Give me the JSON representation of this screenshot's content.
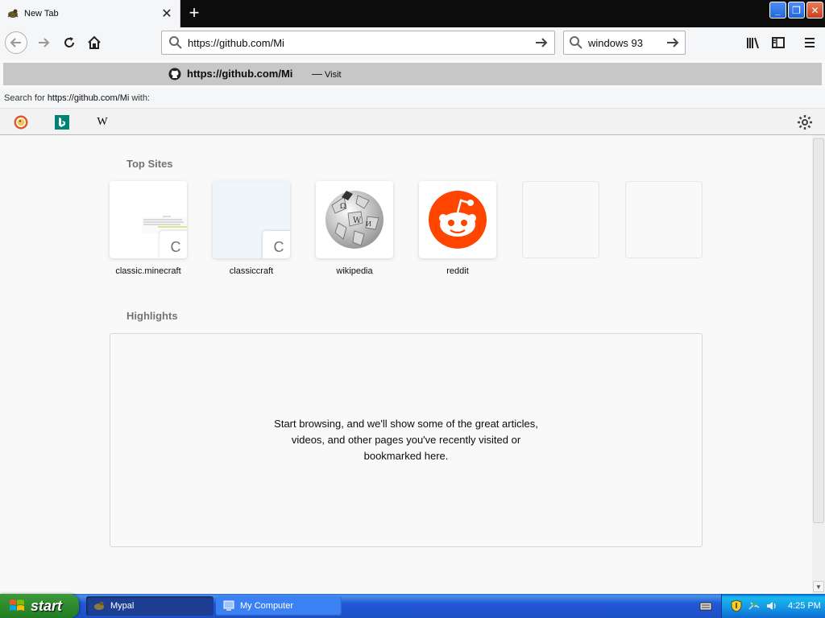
{
  "tab": {
    "title": "New Tab",
    "close_symbol": "✕"
  },
  "newtab": {
    "symbol": "+"
  },
  "window_controls": {
    "minimize": "_",
    "restore": "❐",
    "close": "✕"
  },
  "urlbar": {
    "value": "https://github.com/Mi"
  },
  "searchbar": {
    "value": "windows 93"
  },
  "autocomplete": {
    "url": "https://github.com/Mi",
    "dash": "—",
    "action": "Visit",
    "search_with_prefix": "Search for ",
    "search_with_query": "https://github.com/Mi",
    "search_with_suffix": " with:",
    "engines": [
      "DuckDuckGo",
      "Bing",
      "Wikipedia"
    ],
    "wiki_letter": "W"
  },
  "top_sites": {
    "title": "Top Sites",
    "sites": [
      {
        "label": "classic.minecraft",
        "badge": "C"
      },
      {
        "label": "classiccraft",
        "badge": "C"
      },
      {
        "label": "wikipedia",
        "badge": ""
      },
      {
        "label": "reddit",
        "badge": ""
      },
      {
        "label": "",
        "badge": ""
      },
      {
        "label": "",
        "badge": ""
      }
    ]
  },
  "highlights": {
    "title": "Highlights",
    "empty_message": "Start browsing, and we'll show some of the great articles, videos, and other pages you've recently visited or bookmarked here."
  },
  "taskbar": {
    "start_label": "start",
    "items": [
      "Mypal",
      "My Computer"
    ],
    "clock": "4:25 PM"
  },
  "colors": {
    "reddit": "#ff4500",
    "taskbar_blue": "#245edb",
    "start_green": "#3c9a3c"
  }
}
